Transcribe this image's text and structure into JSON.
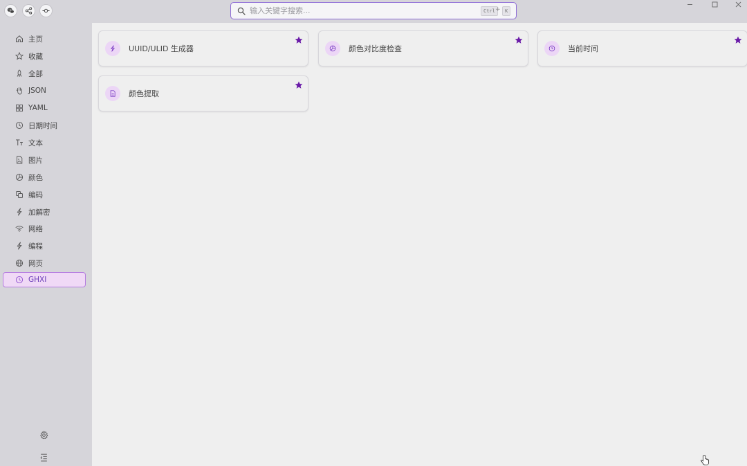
{
  "titlebar": {
    "search_placeholder": "输入关键字搜索...",
    "shortcut_ctrl": "Ctrl",
    "shortcut_plus": "+",
    "shortcut_key": "K"
  },
  "sidebar": {
    "items": [
      {
        "label": "主页",
        "icon": "home-icon"
      },
      {
        "label": "收藏",
        "icon": "star-icon"
      },
      {
        "label": "全部",
        "icon": "rocket-icon"
      },
      {
        "label": "JSON",
        "icon": "hand-icon"
      },
      {
        "label": "YAML",
        "icon": "grid-icon"
      },
      {
        "label": "日期时间",
        "icon": "clock-icon"
      },
      {
        "label": "文本",
        "icon": "text-size-icon"
      },
      {
        "label": "图片",
        "icon": "image-file-icon"
      },
      {
        "label": "颜色",
        "icon": "palette-icon"
      },
      {
        "label": "编码",
        "icon": "copy-icon"
      },
      {
        "label": "加解密",
        "icon": "bolt-icon"
      },
      {
        "label": "网络",
        "icon": "wifi-icon"
      },
      {
        "label": "编程",
        "icon": "bolt-icon"
      },
      {
        "label": "网页",
        "icon": "globe-icon"
      },
      {
        "label": "GHXI",
        "icon": "clock-icon"
      }
    ],
    "active_index": 14
  },
  "cards": [
    {
      "title": "UUID/ULID 生成器",
      "icon": "bolt-icon",
      "starred": true
    },
    {
      "title": "颜色对比度检查",
      "icon": "palette-icon",
      "starred": true
    },
    {
      "title": "当前时间",
      "icon": "clock-icon",
      "starred": true
    },
    {
      "title": "颜色提取",
      "icon": "file-icon",
      "starred": true
    }
  ],
  "colors": {
    "accent": "#6a1aa8",
    "active_bg": "#f0d9f6",
    "active_border": "#b57de0",
    "icon_bg": "#ecd6f6"
  }
}
